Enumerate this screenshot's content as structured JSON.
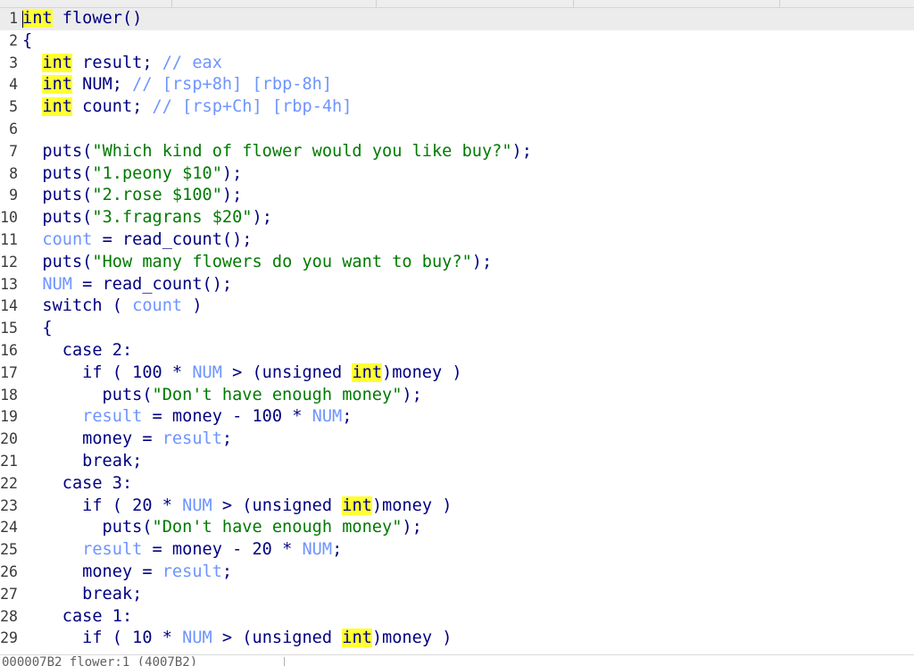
{
  "status": {
    "location": "000007B2 flower:1 (4007B2)"
  },
  "colors": {
    "default": "#000080",
    "string": "#007a00",
    "variable": "#6e94ff",
    "comment": "#6e94ff",
    "keyword_highlight": "#ffff33"
  },
  "lines": [
    {
      "n": "1",
      "current": true,
      "t": [
        [
          "kw",
          "int"
        ],
        [
          "plain",
          " flower()"
        ]
      ]
    },
    {
      "n": "2",
      "t": [
        [
          "plain",
          "{"
        ]
      ]
    },
    {
      "n": "3",
      "t": [
        [
          "plain",
          "  "
        ],
        [
          "kw",
          "int"
        ],
        [
          "plain",
          " result; "
        ],
        [
          "cmt",
          "// eax"
        ]
      ]
    },
    {
      "n": "4",
      "t": [
        [
          "plain",
          "  "
        ],
        [
          "kw",
          "int"
        ],
        [
          "plain",
          " NUM; "
        ],
        [
          "cmt",
          "// [rsp+8h] [rbp-8h]"
        ]
      ]
    },
    {
      "n": "5",
      "t": [
        [
          "plain",
          "  "
        ],
        [
          "kw",
          "int"
        ],
        [
          "plain",
          " count; "
        ],
        [
          "cmt",
          "// [rsp+Ch] [rbp-4h]"
        ]
      ]
    },
    {
      "n": "6",
      "t": []
    },
    {
      "n": "7",
      "t": [
        [
          "plain",
          "  puts("
        ],
        [
          "str",
          "\"Which kind of flower would you like buy?\""
        ],
        [
          "plain",
          ");"
        ]
      ]
    },
    {
      "n": "8",
      "t": [
        [
          "plain",
          "  puts("
        ],
        [
          "str",
          "\"1.peony $10\""
        ],
        [
          "plain",
          ");"
        ]
      ]
    },
    {
      "n": "9",
      "t": [
        [
          "plain",
          "  puts("
        ],
        [
          "str",
          "\"2.rose $100\""
        ],
        [
          "plain",
          ");"
        ]
      ]
    },
    {
      "n": "10",
      "t": [
        [
          "plain",
          "  puts("
        ],
        [
          "str",
          "\"3.fragrans $20\""
        ],
        [
          "plain",
          ");"
        ]
      ]
    },
    {
      "n": "11",
      "t": [
        [
          "plain",
          "  "
        ],
        [
          "var",
          "count"
        ],
        [
          "plain",
          " = read_count();"
        ]
      ]
    },
    {
      "n": "12",
      "t": [
        [
          "plain",
          "  puts("
        ],
        [
          "str",
          "\"How many flowers do you want to buy?\""
        ],
        [
          "plain",
          ");"
        ]
      ]
    },
    {
      "n": "13",
      "t": [
        [
          "plain",
          "  "
        ],
        [
          "var",
          "NUM"
        ],
        [
          "plain",
          " = read_count();"
        ]
      ]
    },
    {
      "n": "14",
      "t": [
        [
          "plain",
          "  switch ( "
        ],
        [
          "var",
          "count"
        ],
        [
          "plain",
          " )"
        ]
      ]
    },
    {
      "n": "15",
      "t": [
        [
          "plain",
          "  {"
        ]
      ]
    },
    {
      "n": "16",
      "t": [
        [
          "plain",
          "    case 2:"
        ]
      ]
    },
    {
      "n": "17",
      "t": [
        [
          "plain",
          "      if ( 100 * "
        ],
        [
          "var",
          "NUM"
        ],
        [
          "plain",
          " > (unsigned "
        ],
        [
          "kw",
          "int"
        ],
        [
          "plain",
          ")money )"
        ]
      ]
    },
    {
      "n": "18",
      "t": [
        [
          "plain",
          "        puts("
        ],
        [
          "str",
          "\"Don't have enough money\""
        ],
        [
          "plain",
          ");"
        ]
      ]
    },
    {
      "n": "19",
      "t": [
        [
          "plain",
          "      "
        ],
        [
          "var",
          "result"
        ],
        [
          "plain",
          " = money - 100 * "
        ],
        [
          "var",
          "NUM"
        ],
        [
          "plain",
          ";"
        ]
      ]
    },
    {
      "n": "20",
      "t": [
        [
          "plain",
          "      money = "
        ],
        [
          "var",
          "result"
        ],
        [
          "plain",
          ";"
        ]
      ]
    },
    {
      "n": "21",
      "t": [
        [
          "plain",
          "      break;"
        ]
      ]
    },
    {
      "n": "22",
      "t": [
        [
          "plain",
          "    case 3:"
        ]
      ]
    },
    {
      "n": "23",
      "t": [
        [
          "plain",
          "      if ( 20 * "
        ],
        [
          "var",
          "NUM"
        ],
        [
          "plain",
          " > (unsigned "
        ],
        [
          "kw",
          "int"
        ],
        [
          "plain",
          ")money )"
        ]
      ]
    },
    {
      "n": "24",
      "t": [
        [
          "plain",
          "        puts("
        ],
        [
          "str",
          "\"Don't have enough money\""
        ],
        [
          "plain",
          ");"
        ]
      ]
    },
    {
      "n": "25",
      "t": [
        [
          "plain",
          "      "
        ],
        [
          "var",
          "result"
        ],
        [
          "plain",
          " = money - 20 * "
        ],
        [
          "var",
          "NUM"
        ],
        [
          "plain",
          ";"
        ]
      ]
    },
    {
      "n": "26",
      "t": [
        [
          "plain",
          "      money = "
        ],
        [
          "var",
          "result"
        ],
        [
          "plain",
          ";"
        ]
      ]
    },
    {
      "n": "27",
      "t": [
        [
          "plain",
          "      break;"
        ]
      ]
    },
    {
      "n": "28",
      "t": [
        [
          "plain",
          "    case 1:"
        ]
      ]
    },
    {
      "n": "29",
      "t": [
        [
          "plain",
          "      if ( 10 * "
        ],
        [
          "var",
          "NUM"
        ],
        [
          "plain",
          " > (unsigned "
        ],
        [
          "kw",
          "int"
        ],
        [
          "plain",
          ")money )"
        ]
      ]
    }
  ]
}
